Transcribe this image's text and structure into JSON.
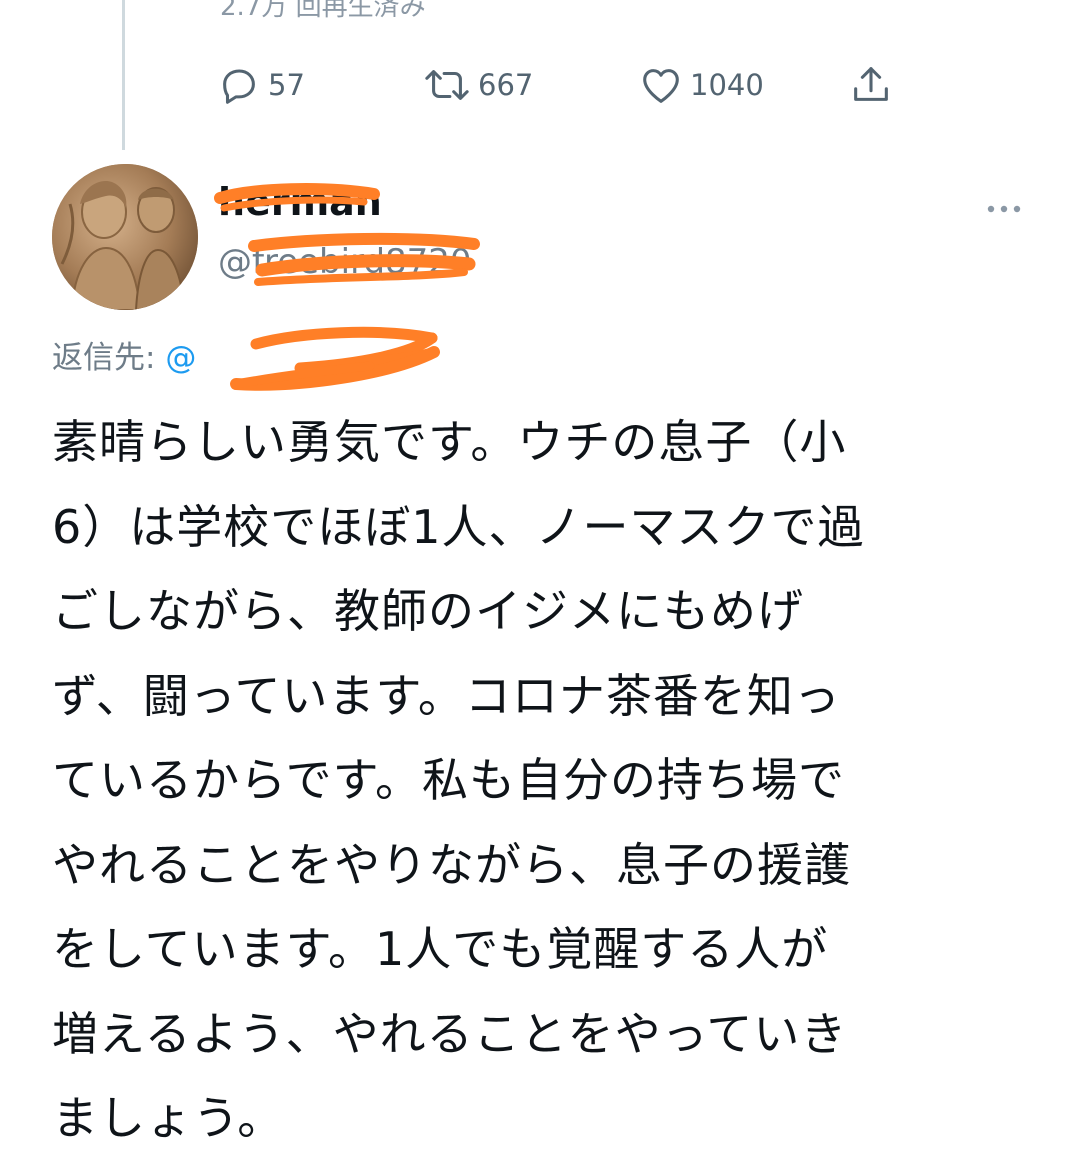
{
  "previous_tweet": {
    "views_text": "2.7万 回再生済み",
    "actions": {
      "reply_count": "57",
      "retweet_count": "667",
      "like_count": "1040"
    }
  },
  "tweet": {
    "display_name": "herman",
    "handle": "@freebird8720",
    "reply_to_label": "返信先:",
    "reply_to_mention": "@",
    "body_lines": [
      "素晴らしい勇気です。ウチの息子（小",
      "6）は学校でほぼ1人、ノーマスクで過",
      "ごしながら、教師のイジメにもめげ",
      "ず、闘っています。コロナ茶番を知っ",
      "ているからです。私も自分の持ち場で",
      "やれることをやりながら、息子の援護",
      "をしています。1人でも覚醒する人が",
      "増えるよう、やれることをやっていき",
      "ましょう。"
    ]
  },
  "icons": {
    "reply": "reply-icon",
    "retweet": "retweet-icon",
    "like": "heart-icon",
    "share": "share-icon",
    "more": "more-icon"
  },
  "colors": {
    "accent": "#1d9bf0",
    "muted": "#536471",
    "redaction": "#ff7f27"
  }
}
